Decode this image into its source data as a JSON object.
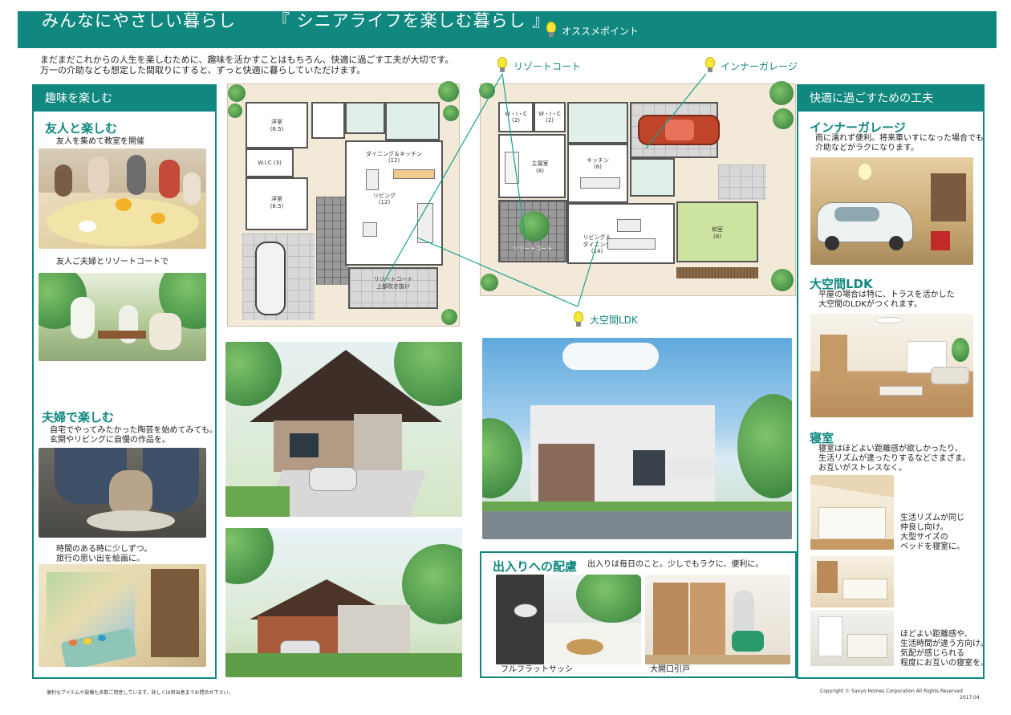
{
  "header": {
    "title": "みんなにやさしい暮らし",
    "subtitle": "『 シニアライフを楽しむ暮らし 』",
    "point_label": "オススメポイント"
  },
  "intro": {
    "line1": "まだまだこれからの人生を楽しむために、趣味を活かすことはもちろん、快適に過ごす工夫が大切です。",
    "line2": "万一の介助なども想定した間取りにすると、ずっと快適に暮らしていただけます。"
  },
  "hobby_panel": {
    "title": "趣味を楽しむ",
    "friends": {
      "heading": "友人と楽しむ",
      "caption1": "友人を集めて教室を開催",
      "caption2": "友人ご夫婦とリゾートコートで"
    },
    "couple": {
      "heading": "夫婦で楽しむ",
      "caption1_l1": "自宅でやってみたかった陶芸を始めてみても。",
      "caption1_l2": "玄関やリビングに自慢の作品を。",
      "caption2_l1": "時間のある時に少しずつ。",
      "caption2_l2": "旅行の思い出を絵画に。"
    }
  },
  "comfort_panel": {
    "title": "快適に過ごすための工夫",
    "garage": {
      "heading": "インナーガレージ",
      "text_l1": "雨に濡れず便利。将来車いすになった場合でも",
      "text_l2": "介助などがラクになります。"
    },
    "ldk": {
      "heading": "大空間LDK",
      "text_l1": "平屋の場合は特に、トラスを活かした",
      "text_l2": "大空間のLDKがつくれます。"
    },
    "bedroom": {
      "heading": "寝室",
      "text_l1": "寝室はほどよい距離感が欲しかったり、",
      "text_l2": "生活リズムが違ったりするなどさまざま。",
      "text_l3": "お互いがストレスなく。",
      "note1": [
        "生活リズムが同じ",
        "仲良し向け。",
        "大型サイズの",
        "ベッドを寝室に。"
      ],
      "note2": [
        "ほどよい距離感や、",
        "生活時間が違う方向け。",
        "気配が感じられる",
        "程度にお互いの寝室を。"
      ]
    }
  },
  "callouts": {
    "resort": "リゾートコート",
    "garage": "インナーガレージ",
    "ldk": "大空間LDK"
  },
  "plan_left": {
    "rooms": {
      "yoshitsu1": "洋室",
      "yoshitsu1_size": "(6.5)",
      "wic": "W.I.C (3)",
      "yoshitsu2": "洋室",
      "yoshitsu2_size": "(6.5)",
      "dining": "ダイニング＆キッチン",
      "dining_size": "(12)",
      "living": "リビング",
      "living_size": "(12)",
      "resort": "リゾートコート",
      "resort_sub": "上部吹き抜け"
    }
  },
  "plan_right": {
    "rooms": {
      "wic1": "W・I・C",
      "wic1_size": "(2)",
      "wic2": "W・I・C",
      "wic2_size": "(2)",
      "master": "主寝室",
      "master_size": "(8)",
      "kitchen": "キッチン",
      "kitchen_size": "(6)",
      "resort": "リゾートコート",
      "ld": "リビング＆",
      "ld2": "ダイニング",
      "ld_size": "(14)",
      "washitsu": "和室",
      "washitsu_size": "(8)"
    }
  },
  "entry_panel": {
    "title": "出入りへの配慮",
    "text": "出入りは毎日のこと。少しでもラクに、便利に。",
    "caption1": "フルフラットサッシ",
    "caption2": "大開口引戸"
  },
  "footer": {
    "left": "便利なアイテムや設備も多数ご用意しています。詳しくは担当者までお問合せ下さい。",
    "right": "Copyright ©  Sanyo Homes Corporation All Rights Reserved",
    "date": "2017.04"
  },
  "colors": {
    "accent": "#10887f",
    "callout_line": "#17a090"
  }
}
